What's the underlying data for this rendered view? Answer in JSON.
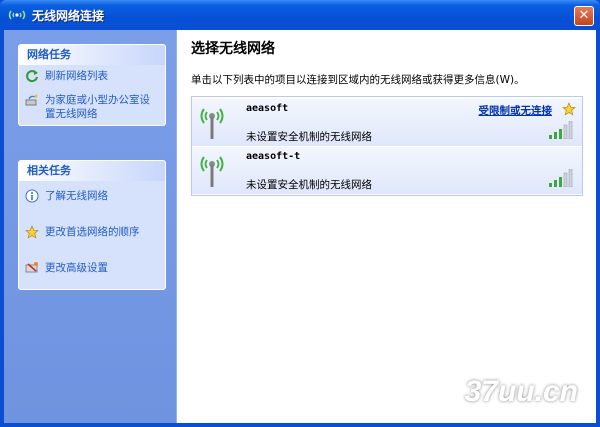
{
  "window": {
    "title": "无线网络连接",
    "close_symbol": "✕"
  },
  "left": {
    "network_tasks": {
      "header": "网络任务",
      "items": [
        {
          "label": "刷新网络列表",
          "icon": "refresh-icon"
        },
        {
          "label": "为家庭或小型办公室设置无线网络",
          "icon": "wizard-icon"
        }
      ]
    },
    "related_tasks": {
      "header": "相关任务",
      "items": [
        {
          "label": "了解无线网络",
          "icon": "info-icon"
        },
        {
          "label": "更改首选网络的顺序",
          "icon": "star-icon"
        },
        {
          "label": "更改高级设置",
          "icon": "settings-icon"
        }
      ]
    }
  },
  "main": {
    "title": "选择无线网络",
    "subtitle": "单击以下列表中的项目以连接到区域内的无线网络或获得更多信息(W)。",
    "networks": [
      {
        "ssid": "aeasoft",
        "status": "未设置安全机制的无线网络",
        "connection": "受限制或无连接",
        "preferred": true,
        "signal_bars": 5,
        "active_bars": 3
      },
      {
        "ssid": "aeasoft-t",
        "status": "未设置安全机制的无线网络",
        "connection": "",
        "preferred": false,
        "signal_bars": 5,
        "active_bars": 3
      }
    ]
  },
  "watermark": "37uu.cn",
  "colors": {
    "title_bar": "#0a4fd1",
    "task_link": "#215dc6",
    "left_pane": "#7a9ee8",
    "connection_link": "#0033aa",
    "signal_active": "#3ea63e"
  }
}
